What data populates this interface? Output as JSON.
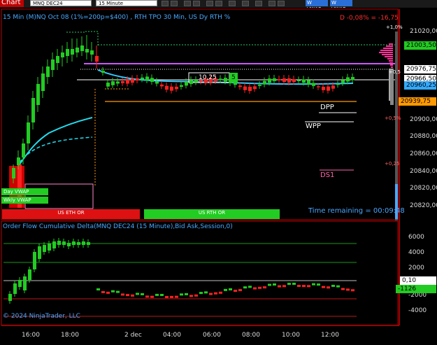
{
  "toolbar": {
    "chart_tab": "Chart",
    "instrument": "MNQ DEC24",
    "interval": "15 Minute",
    "buttons": [
      "bar-type",
      "lines",
      "zoom-in",
      "zoom-out",
      "indicators",
      "strategies",
      "drawing",
      "properties",
      "data-box",
      "crosshair",
      "select"
    ],
    "right_buttons": [
      "W VWAP",
      "W VWAP"
    ]
  },
  "price_panel": {
    "title": "15 Min (M)NQ Oct 08 (1%=200p=$400) , RTH TPO 30 Min, US Dy RTH %",
    "delta_text": "D -0,08% = -16,75",
    "axis_ticks": [
      "21020,00",
      "21000,00",
      "20980,00",
      "20960,00",
      "20940,00",
      "20920,00",
      "20900,00",
      "20880,00",
      "20860,00",
      "20840,00",
      "20820,00"
    ],
    "axis_tags": [
      {
        "text": "21003,50",
        "color": "#22cc22"
      },
      {
        "text": "20976,75",
        "color": "#ffffff"
      },
      {
        "text": "20966,50",
        "color": "#ffffff"
      },
      {
        "text": "20960,25",
        "color": "#33aaff"
      },
      {
        "text": "20939,75",
        "color": "#ff9900"
      }
    ],
    "pct_labels": [
      "+1,0%",
      "+0,5",
      "+0,5%",
      "+0,25"
    ],
    "level_labels": [
      "DPP",
      "WPP",
      "DS1"
    ],
    "box_labels": [
      "10,25",
      "5"
    ],
    "vwap_tags": [
      "Day VWAP",
      "Wkly VWAP"
    ],
    "session_labels": [
      "US ETH OR",
      "US RTH OR"
    ],
    "time_remaining": "Time remaining = 00:09:48"
  },
  "orderflow_panel": {
    "title": "Order Flow Cumulative Delta(MNQ DEC24 (15 Minute),Bid Ask,Session,0)",
    "axis_ticks": [
      "6000",
      "4000",
      "2000",
      "0",
      "-2000",
      "-4000"
    ],
    "axis_tags": [
      {
        "text": "0,10",
        "color": "#ffffff"
      },
      {
        "text": "-1126",
        "color": "#22cc22"
      }
    ]
  },
  "time_axis": [
    "16:00",
    "18:00",
    "2 dec",
    "04:00",
    "06:00",
    "08:00",
    "10:00",
    "12:00"
  ],
  "copyright": "© 2024 NinjaTrader, LLC",
  "colors": {
    "up": "#22cc22",
    "down": "#ff2020",
    "accent": "#4aa8ff",
    "border": "#cc0000"
  }
}
